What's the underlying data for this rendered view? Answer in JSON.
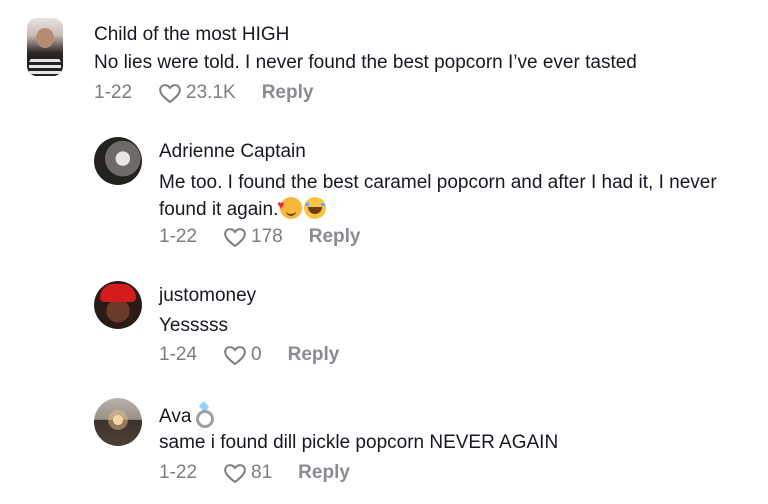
{
  "comments": [
    {
      "username": "Child of the most HIGH",
      "text": "No lies were told. I never found the best popcorn I’ve ever tasted",
      "date": "1-22",
      "likes": "23.1K",
      "reply": "Reply",
      "avatar_icon": "user-avatar"
    },
    {
      "username": "Adrienne Captain",
      "text": "Me too. I found the best caramel popcorn and after I had it, I never found it again.",
      "emojis": [
        "smiling-face-with-hearts",
        "face-with-tears-of-joy"
      ],
      "date": "1-22",
      "likes": "178",
      "reply": "Reply",
      "avatar_icon": "user-avatar"
    },
    {
      "username": "justomoney",
      "text": "Yesssss",
      "date": "1-24",
      "likes": "0",
      "reply": "Reply",
      "avatar_icon": "user-avatar"
    },
    {
      "username": "Ava",
      "username_icon": "ring-icon",
      "text": "same i found dill pickle popcorn NEVER AGAIN",
      "date": "1-22",
      "likes": "81",
      "reply": "Reply",
      "avatar_icon": "user-avatar"
    }
  ],
  "colors": {
    "text": "#161823",
    "meta": "#7c7d84",
    "background": "#ffffff"
  }
}
